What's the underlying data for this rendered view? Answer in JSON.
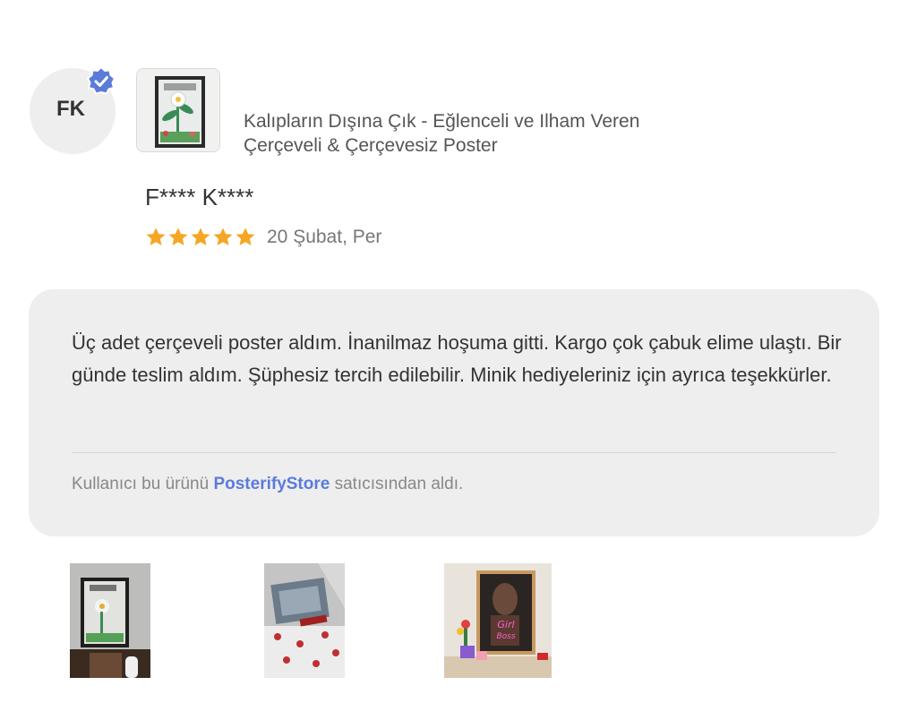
{
  "reviewer": {
    "initials": "FK",
    "name": "F**** K****",
    "verified": true
  },
  "product": {
    "title_line1": "Kalıpların Dışına Çık - Eğlenceli ve Ilham Veren",
    "title_line2": "Çerçeveli & Çerçevesiz Poster"
  },
  "rating": {
    "stars": 5,
    "max": 5,
    "color": "#f5a623"
  },
  "date": "20 Şubat, Per",
  "review": {
    "text": "Üç adet çerçeveli poster aldım. İnanilmaz hoşuma gitti. Kargo çok çabuk elime ulaştı. Bir günde teslim aldım. Şüphesiz tercih edilebilir. Minik hediyeleriniz için ayrıca teşekkürler."
  },
  "seller": {
    "prefix": "Kullanıcı bu ürünü ",
    "name": "PosterifyStore",
    "suffix": " satıcısından aldı.",
    "link_color": "#5b7bdb"
  },
  "colors": {
    "verified_badge": "#5b7bdb",
    "bubble_bg": "#eeeeee"
  }
}
